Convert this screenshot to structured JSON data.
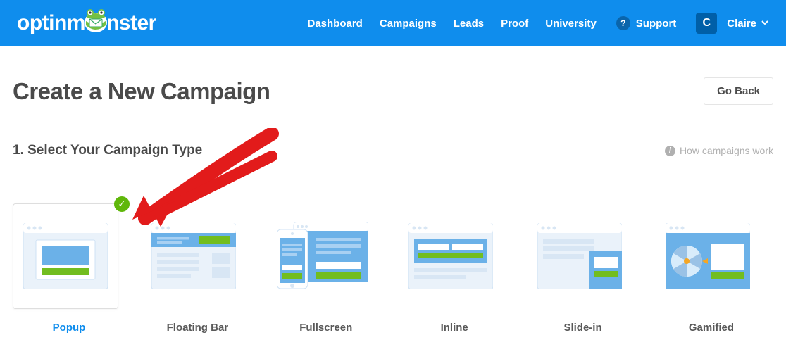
{
  "brand": "optinmonster",
  "nav": {
    "links": [
      "Dashboard",
      "Campaigns",
      "Leads",
      "Proof",
      "University"
    ],
    "support": "Support",
    "userInitial": "C",
    "userName": "Claire"
  },
  "page": {
    "title": "Create a New Campaign",
    "goBack": "Go Back",
    "stepLabel": "1. Select Your Campaign Type",
    "howLink": "How campaigns work"
  },
  "types": [
    {
      "label": "Popup",
      "selected": true
    },
    {
      "label": "Floating Bar",
      "selected": false
    },
    {
      "label": "Fullscreen",
      "selected": false
    },
    {
      "label": "Inline",
      "selected": false
    },
    {
      "label": "Slide-in",
      "selected": false
    },
    {
      "label": "Gamified",
      "selected": false
    }
  ]
}
